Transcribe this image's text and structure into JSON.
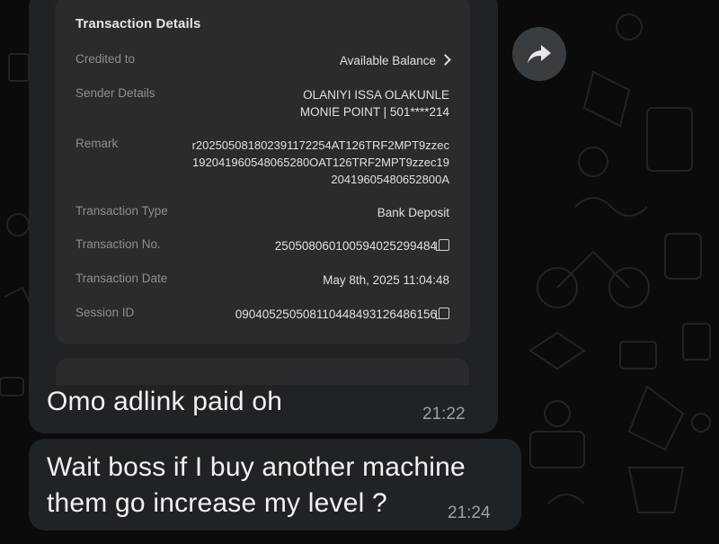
{
  "receipt": {
    "title": "Transaction Details",
    "rows": [
      {
        "label": "Credited to",
        "value": "Available Balance"
      },
      {
        "label": "Sender Details",
        "value_line1": "OLANIYI ISSA OLAKUNLE",
        "value_line2": "MONIE POINT | 501****214"
      },
      {
        "label": "Remark",
        "value_line1": "r202505081802391172254AT126TRF2MPT9zzec",
        "value_line2": "192041960548065280OAT126TRF2MPT9zzec19",
        "value_line3": "20419605480652800A"
      },
      {
        "label": "Transaction Type",
        "value": "Bank Deposit"
      },
      {
        "label": "Transaction No.",
        "value": "250508060100594025299484"
      },
      {
        "label": "Transaction Date",
        "value": "May 8th, 2025 11:04:48"
      },
      {
        "label": "Session ID",
        "value": "090405250508110448493126486156"
      }
    ]
  },
  "messages": [
    {
      "text": "Omo adlink paid oh",
      "time": "21:22"
    },
    {
      "text_line1": "Wait boss if I buy another machine",
      "text_line2": "them go increase my level ?",
      "time": "21:24"
    }
  ],
  "icons": {
    "forward": "forward-arrow-icon",
    "chevron": "chevron-right-icon",
    "copy": "copy-icon"
  },
  "colors": {
    "background": "#0b0b0b",
    "bubble": "#1f2325",
    "card": "#2a2b2d",
    "forward_button": "#3a3d40"
  }
}
